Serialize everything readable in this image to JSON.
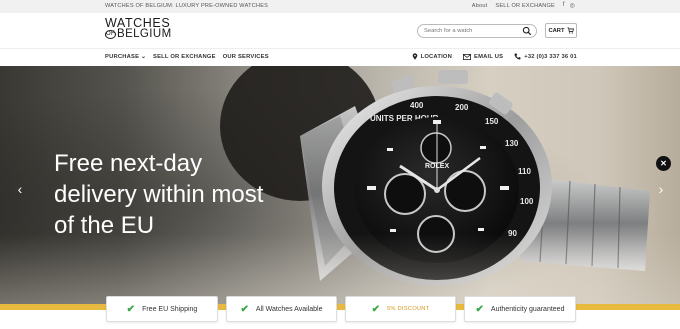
{
  "topbar": {
    "announcement": "WATCHES OF BELGIUM: LUXURY PRE-OWNED WATCHES",
    "links": [
      {
        "label": "About"
      },
      {
        "label": "SELL OR EXCHANGE"
      }
    ],
    "social": [
      {
        "icon": "facebook-icon",
        "glyph": "f"
      },
      {
        "icon": "instagram-icon",
        "glyph": "◎"
      }
    ]
  },
  "header": {
    "logo_line1": "WATCHES",
    "logo_of": "OF",
    "logo_line2": "BELGIUM",
    "search_placeholder": "Search for a watch",
    "cart_label": "CART"
  },
  "nav": {
    "left": [
      {
        "label": "PURCHASE ⌄"
      },
      {
        "label": "SELL OR EXCHANGE"
      },
      {
        "label": "OUR SERVICES"
      }
    ],
    "right": [
      {
        "icon": "location-pin-icon",
        "label": "LOCATION"
      },
      {
        "icon": "mail-icon",
        "label": "EMAIL US"
      },
      {
        "icon": "phone-icon",
        "label": "+32 (0)3 337 36 01"
      }
    ]
  },
  "hero": {
    "headline_lines": [
      "Free next-day",
      "delivery within most",
      "of the EU"
    ],
    "prev_glyph": "‹",
    "next_glyph": "›",
    "close_glyph": "✕",
    "watch_brand": "ROLEX"
  },
  "features": [
    {
      "label": "Free EU Shipping"
    },
    {
      "label": "All Watches Available"
    },
    {
      "label": "5% DISCOUNT"
    },
    {
      "label": "Authenticity guaranteed"
    }
  ],
  "colors": {
    "accent_gold": "#e8b93f",
    "check_green": "#3aa74a",
    "discount_orange": "#d59a22"
  }
}
